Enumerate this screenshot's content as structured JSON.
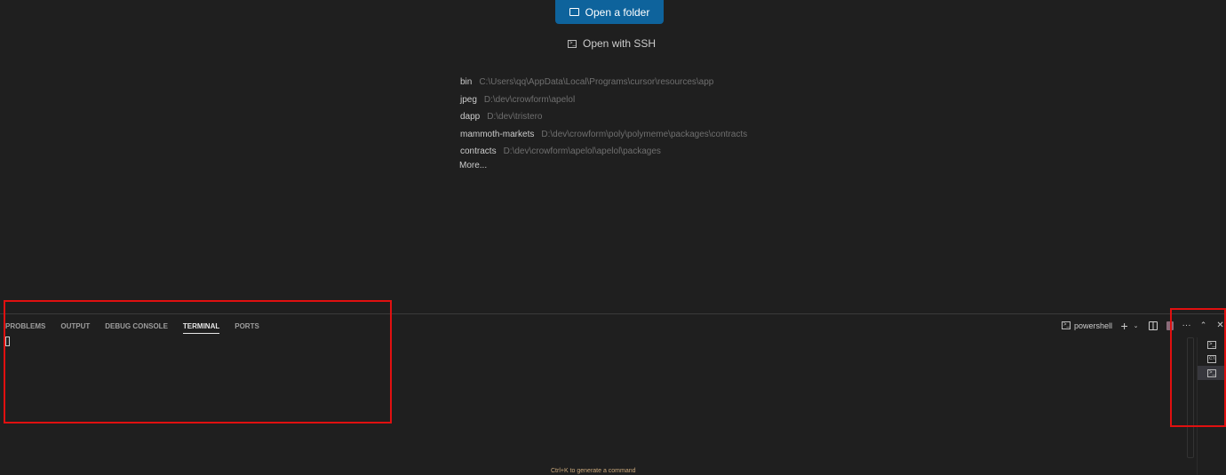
{
  "welcome": {
    "open_folder": "Open a folder",
    "open_ssh": "Open with SSH",
    "recent": [
      {
        "name": "bin",
        "path": "C:\\Users\\qq\\AppData\\Local\\Programs\\cursor\\resources\\app"
      },
      {
        "name": "jpeg",
        "path": "D:\\dev\\crowform\\apelol"
      },
      {
        "name": "dapp",
        "path": "D:\\dev\\tristero"
      },
      {
        "name": "mammoth-markets",
        "path": "D:\\dev\\crowform\\poly\\polymeme\\packages\\contracts"
      },
      {
        "name": "contracts",
        "path": "D:\\dev\\crowform\\apelol\\apelol\\packages"
      }
    ],
    "more": "More..."
  },
  "panel": {
    "tabs": [
      "PROBLEMS",
      "OUTPUT",
      "DEBUG CONSOLE",
      "TERMINAL",
      "PORTS"
    ],
    "active_tab": "TERMINAL",
    "terminal_name": "powershell",
    "hint": "Ctrl+K to generate a command"
  },
  "colors": {
    "accent": "#0e639c",
    "annotation": "#e01010"
  }
}
